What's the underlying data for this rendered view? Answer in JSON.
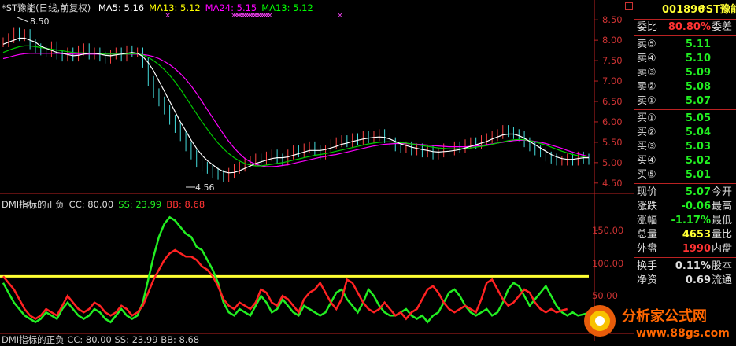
{
  "stock": {
    "name": "*ST豫能",
    "code": "001896",
    "title_line": "*ST豫能(日线,前复权)"
  },
  "ma_legend": [
    {
      "label": "MA5: 5.16",
      "color": "#ffffff"
    },
    {
      "label": "MA13: 5.12",
      "color": "#ffff00"
    },
    {
      "label": "MA24: 5.15",
      "color": "#ff00ff"
    },
    {
      "label": "MA13: 5.12",
      "color": "#00ff00"
    }
  ],
  "indicator_legend": [
    {
      "label": "DMI指标的正负",
      "color": "#dddddd"
    },
    {
      "label": "CC: 80.00",
      "color": "#dddddd"
    },
    {
      "label": "SS: 23.99",
      "color": "#22ee22"
    },
    {
      "label": "BB: 8.68",
      "color": "#ff3333"
    }
  ],
  "indicator_legend_2": "DMI指标的正负  CC: 80.00  SS: 23.99  BB: 8.68",
  "price_axis_labels": [
    "8.50",
    "8.00",
    "7.50",
    "7.00",
    "6.50",
    "6.00",
    "5.50",
    "5.00",
    "4.50"
  ],
  "indicator_axis_labels": [
    "150.00",
    "100.00",
    "50.00"
  ],
  "annotations": {
    "high": "8.50",
    "low": "4.56"
  },
  "panel": {
    "header_code": "001896",
    "header_name": "*ST豫能",
    "weibi_label": "委比",
    "weibi_value": "80.80%",
    "weicha_label": "委差",
    "asks": [
      {
        "label": "卖⑤",
        "price": "5.11"
      },
      {
        "label": "卖④",
        "price": "5.10"
      },
      {
        "label": "卖③",
        "price": "5.09"
      },
      {
        "label": "卖②",
        "price": "5.08"
      },
      {
        "label": "卖①",
        "price": "5.07"
      }
    ],
    "bids": [
      {
        "label": "买①",
        "price": "5.05"
      },
      {
        "label": "买②",
        "price": "5.04"
      },
      {
        "label": "买③",
        "price": "5.03"
      },
      {
        "label": "买④",
        "price": "5.02"
      },
      {
        "label": "买⑤",
        "price": "5.01"
      }
    ],
    "quote": [
      {
        "label": "现价",
        "value": "5.07",
        "extra": "今开",
        "color": "#22ee22"
      },
      {
        "label": "涨跌",
        "value": "-0.06",
        "extra": "最高",
        "color": "#22ee22"
      },
      {
        "label": "涨幅",
        "value": "-1.17%",
        "extra": "最低",
        "color": "#22ee22"
      },
      {
        "label": "总量",
        "value": "4653",
        "extra": "量比",
        "color": "#ffff33"
      },
      {
        "label": "外盘",
        "value": "1990",
        "extra": "内盘",
        "color": "#ff3333"
      }
    ],
    "stats": [
      {
        "label": "换手",
        "value": "0.11%",
        "extra": "股本",
        "color": "#dddddd"
      },
      {
        "label": "净资",
        "value": "0.69",
        "extra": "流通",
        "color": "#dddddd"
      }
    ]
  },
  "watermark": {
    "text": "分析家公式网",
    "url": "www.88gs.com"
  },
  "chart_data": {
    "type": "line",
    "price_range": [
      4.4,
      8.6
    ],
    "indicator_range": [
      0,
      180
    ],
    "threshold": 80.0,
    "close": [
      7.95,
      8.05,
      8.2,
      8.1,
      8.15,
      7.9,
      7.8,
      7.75,
      7.7,
      7.85,
      7.65,
      7.6,
      7.7,
      7.6,
      7.75,
      7.8,
      7.65,
      7.7,
      7.6,
      7.55,
      7.65,
      7.7,
      7.6,
      7.75,
      7.7,
      7.7,
      7.45,
      7.0,
      6.7,
      6.5,
      6.3,
      6.05,
      5.85,
      5.65,
      5.4,
      5.2,
      5.0,
      4.9,
      4.85,
      4.75,
      4.7,
      4.65,
      4.75,
      4.85,
      4.9,
      5.0,
      5.05,
      5.1,
      5.05,
      5.15,
      5.2,
      5.1,
      5.05,
      5.2,
      5.3,
      5.25,
      5.35,
      5.4,
      5.3,
      5.2,
      5.3,
      5.45,
      5.5,
      5.55,
      5.5,
      5.6,
      5.55,
      5.65,
      5.6,
      5.65,
      5.7,
      5.6,
      5.5,
      5.4,
      5.35,
      5.4,
      5.3,
      5.35,
      5.25,
      5.3,
      5.2,
      5.25,
      5.35,
      5.3,
      5.4,
      5.35,
      5.45,
      5.5,
      5.45,
      5.55,
      5.6,
      5.65,
      5.7,
      5.8,
      5.75,
      5.7,
      5.65,
      5.5,
      5.4,
      5.3,
      5.25,
      5.15,
      5.1,
      5.05,
      5.05,
      5.1,
      5.05,
      5.15,
      5.1,
      5.07
    ],
    "ma_fast": [
      7.9,
      7.95,
      8.0,
      8.05,
      8.05,
      8.0,
      7.95,
      7.85,
      7.8,
      7.75,
      7.7,
      7.68,
      7.65,
      7.62,
      7.63,
      7.66,
      7.68,
      7.68,
      7.66,
      7.63,
      7.62,
      7.64,
      7.66,
      7.68,
      7.7,
      7.68,
      7.6,
      7.45,
      7.25,
      7.0,
      6.75,
      6.5,
      6.25,
      6.0,
      5.78,
      5.55,
      5.35,
      5.18,
      5.05,
      4.95,
      4.85,
      4.78,
      4.75,
      4.76,
      4.8,
      4.86,
      4.92,
      4.98,
      5.02,
      5.06,
      5.1,
      5.12,
      5.12,
      5.14,
      5.18,
      5.22,
      5.26,
      5.3,
      5.3,
      5.3,
      5.32,
      5.36,
      5.4,
      5.45,
      5.48,
      5.52,
      5.55,
      5.58,
      5.6,
      5.62,
      5.63,
      5.62,
      5.58,
      5.52,
      5.46,
      5.42,
      5.38,
      5.35,
      5.32,
      5.3,
      5.27,
      5.26,
      5.27,
      5.28,
      5.3,
      5.32,
      5.36,
      5.4,
      5.44,
      5.48,
      5.52,
      5.58,
      5.63,
      5.68,
      5.7,
      5.7,
      5.66,
      5.6,
      5.52,
      5.44,
      5.36,
      5.28,
      5.2,
      5.14,
      5.1,
      5.08,
      5.08,
      5.1,
      5.12,
      5.12
    ],
    "ma_mid": [
      7.7,
      7.75,
      7.8,
      7.84,
      7.86,
      7.86,
      7.84,
      7.82,
      7.8,
      7.78,
      7.76,
      7.74,
      7.72,
      7.7,
      7.69,
      7.69,
      7.68,
      7.68,
      7.67,
      7.66,
      7.66,
      7.66,
      7.66,
      7.66,
      7.67,
      7.67,
      7.64,
      7.58,
      7.5,
      7.4,
      7.28,
      7.14,
      6.98,
      6.8,
      6.6,
      6.4,
      6.2,
      6.0,
      5.82,
      5.64,
      5.48,
      5.34,
      5.22,
      5.12,
      5.04,
      4.98,
      4.94,
      4.92,
      4.92,
      4.94,
      4.96,
      4.98,
      5.0,
      5.03,
      5.06,
      5.09,
      5.12,
      5.15,
      5.18,
      5.2,
      5.22,
      5.25,
      5.28,
      5.31,
      5.34,
      5.37,
      5.4,
      5.43,
      5.46,
      5.48,
      5.5,
      5.51,
      5.51,
      5.5,
      5.49,
      5.48,
      5.46,
      5.44,
      5.42,
      5.4,
      5.38,
      5.36,
      5.35,
      5.34,
      5.34,
      5.34,
      5.35,
      5.36,
      5.38,
      5.4,
      5.42,
      5.45,
      5.48,
      5.51,
      5.54,
      5.56,
      5.57,
      5.56,
      5.54,
      5.51,
      5.47,
      5.43,
      5.38,
      5.33,
      5.28,
      5.24,
      5.2,
      5.17,
      5.14,
      5.12
    ],
    "ma_slow": [
      7.55,
      7.58,
      7.62,
      7.65,
      7.67,
      7.68,
      7.68,
      7.68,
      7.68,
      7.68,
      7.68,
      7.67,
      7.67,
      7.66,
      7.66,
      7.66,
      7.66,
      7.66,
      7.66,
      7.66,
      7.66,
      7.66,
      7.66,
      7.66,
      7.66,
      7.66,
      7.65,
      7.63,
      7.6,
      7.55,
      7.48,
      7.4,
      7.3,
      7.18,
      7.04,
      6.88,
      6.7,
      6.5,
      6.3,
      6.1,
      5.9,
      5.7,
      5.52,
      5.36,
      5.22,
      5.1,
      5.02,
      4.96,
      4.92,
      4.9,
      4.9,
      4.91,
      4.93,
      4.95,
      4.98,
      5.01,
      5.04,
      5.07,
      5.1,
      5.13,
      5.15,
      5.18,
      5.2,
      5.23,
      5.26,
      5.29,
      5.32,
      5.35,
      5.38,
      5.41,
      5.43,
      5.45,
      5.46,
      5.47,
      5.47,
      5.47,
      5.46,
      5.45,
      5.44,
      5.43,
      5.42,
      5.41,
      5.4,
      5.39,
      5.39,
      5.39,
      5.39,
      5.4,
      5.41,
      5.42,
      5.44,
      5.46,
      5.48,
      5.5,
      5.52,
      5.54,
      5.55,
      5.55,
      5.54,
      5.52,
      5.5,
      5.47,
      5.43,
      5.39,
      5.35,
      5.3,
      5.26,
      5.22,
      5.18,
      5.15
    ],
    "ss": [
      70,
      55,
      40,
      30,
      20,
      15,
      10,
      15,
      25,
      20,
      15,
      30,
      40,
      30,
      20,
      15,
      20,
      30,
      25,
      15,
      10,
      20,
      30,
      20,
      15,
      20,
      40,
      75,
      110,
      140,
      160,
      170,
      165,
      155,
      145,
      140,
      125,
      120,
      105,
      90,
      70,
      40,
      25,
      20,
      30,
      25,
      20,
      35,
      50,
      40,
      25,
      30,
      45,
      35,
      25,
      20,
      35,
      30,
      25,
      20,
      25,
      40,
      55,
      60,
      45,
      35,
      25,
      40,
      60,
      50,
      35,
      25,
      20,
      20,
      25,
      30,
      20,
      15,
      20,
      10,
      20,
      25,
      40,
      55,
      60,
      50,
      35,
      25,
      20,
      25,
      30,
      20,
      25,
      40,
      60,
      70,
      65,
      50,
      35,
      45,
      55,
      65,
      50,
      35,
      25,
      20,
      25,
      20,
      22,
      24
    ],
    "bb": [
      80,
      70,
      60,
      45,
      30,
      20,
      15,
      20,
      30,
      25,
      20,
      35,
      50,
      40,
      30,
      25,
      30,
      40,
      35,
      25,
      20,
      25,
      35,
      30,
      20,
      25,
      35,
      55,
      75,
      90,
      105,
      115,
      120,
      115,
      110,
      110,
      105,
      95,
      90,
      80,
      65,
      45,
      35,
      30,
      40,
      35,
      30,
      40,
      60,
      55,
      40,
      35,
      50,
      45,
      35,
      25,
      45,
      55,
      60,
      70,
      55,
      40,
      30,
      45,
      75,
      70,
      55,
      40,
      30,
      25,
      30,
      40,
      30,
      20,
      25,
      15,
      25,
      30,
      45,
      60,
      65,
      55,
      40,
      30,
      25,
      30,
      35,
      30,
      25,
      45,
      70,
      75,
      60,
      45,
      35,
      40,
      50,
      60,
      55,
      40,
      30,
      25,
      30,
      25,
      28,
      30
    ],
    "x_markers": [
      22,
      53,
      54,
      55,
      56,
      57,
      58,
      59,
      60,
      61,
      62,
      63,
      64,
      65,
      66,
      67,
      68,
      69,
      70,
      103
    ]
  }
}
